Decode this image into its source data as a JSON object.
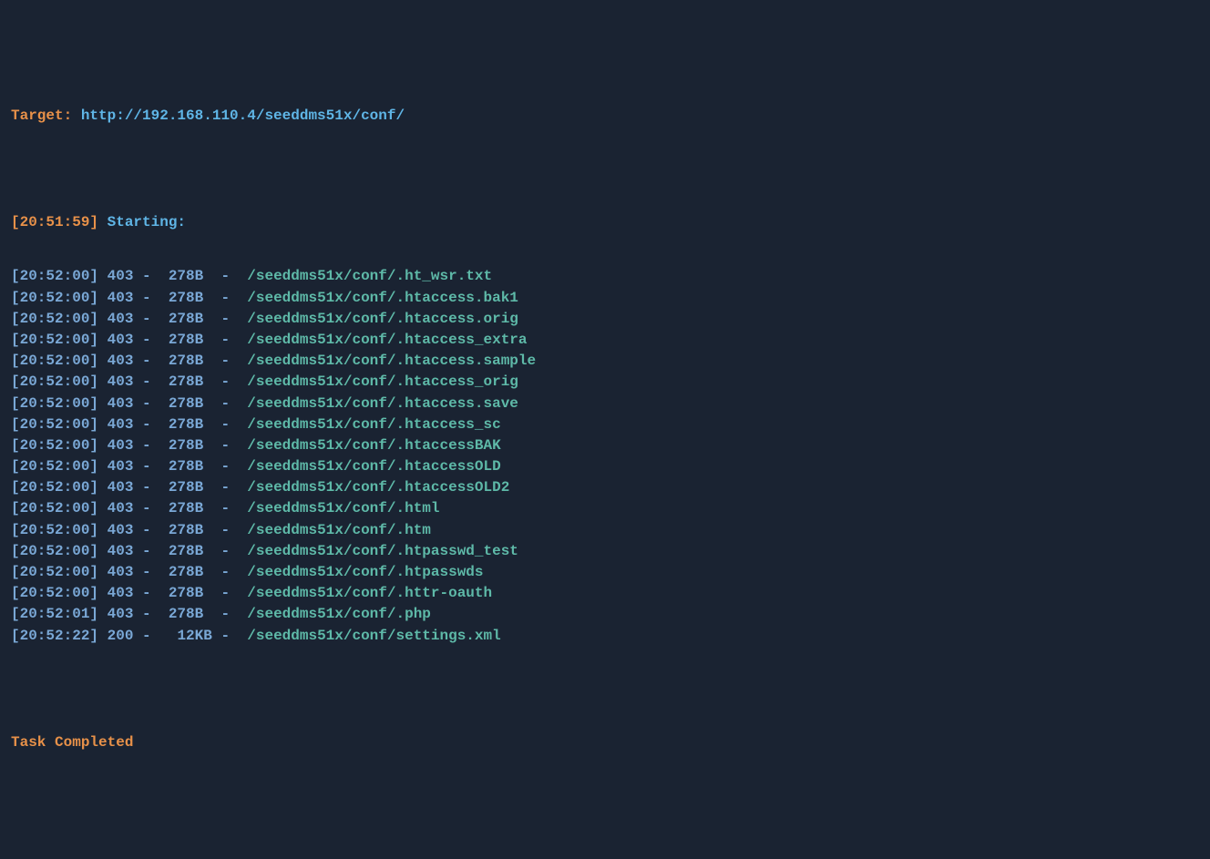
{
  "header": {
    "target_label": "Target: ",
    "target_url": "http://192.168.110.4/seeddms51x/conf/"
  },
  "starting": {
    "timestamp": "[20:51:59]",
    "label": " Starting:"
  },
  "entries": [
    {
      "timestamp": "[20:52:00]",
      "status": " 403 -  ",
      "size": "278B ",
      "dash": " - ",
      "path": " /seeddms51x/conf/.ht_wsr.txt"
    },
    {
      "timestamp": "[20:52:00]",
      "status": " 403 -  ",
      "size": "278B ",
      "dash": " - ",
      "path": " /seeddms51x/conf/.htaccess.bak1"
    },
    {
      "timestamp": "[20:52:00]",
      "status": " 403 -  ",
      "size": "278B ",
      "dash": " - ",
      "path": " /seeddms51x/conf/.htaccess.orig"
    },
    {
      "timestamp": "[20:52:00]",
      "status": " 403 -  ",
      "size": "278B ",
      "dash": " - ",
      "path": " /seeddms51x/conf/.htaccess_extra"
    },
    {
      "timestamp": "[20:52:00]",
      "status": " 403 -  ",
      "size": "278B ",
      "dash": " - ",
      "path": " /seeddms51x/conf/.htaccess.sample"
    },
    {
      "timestamp": "[20:52:00]",
      "status": " 403 -  ",
      "size": "278B ",
      "dash": " - ",
      "path": " /seeddms51x/conf/.htaccess_orig"
    },
    {
      "timestamp": "[20:52:00]",
      "status": " 403 -  ",
      "size": "278B ",
      "dash": " - ",
      "path": " /seeddms51x/conf/.htaccess.save"
    },
    {
      "timestamp": "[20:52:00]",
      "status": " 403 -  ",
      "size": "278B ",
      "dash": " - ",
      "path": " /seeddms51x/conf/.htaccess_sc"
    },
    {
      "timestamp": "[20:52:00]",
      "status": " 403 -  ",
      "size": "278B ",
      "dash": " - ",
      "path": " /seeddms51x/conf/.htaccessBAK"
    },
    {
      "timestamp": "[20:52:00]",
      "status": " 403 -  ",
      "size": "278B ",
      "dash": " - ",
      "path": " /seeddms51x/conf/.htaccessOLD"
    },
    {
      "timestamp": "[20:52:00]",
      "status": " 403 -  ",
      "size": "278B ",
      "dash": " - ",
      "path": " /seeddms51x/conf/.htaccessOLD2"
    },
    {
      "timestamp": "[20:52:00]",
      "status": " 403 -  ",
      "size": "278B ",
      "dash": " - ",
      "path": " /seeddms51x/conf/.html"
    },
    {
      "timestamp": "[20:52:00]",
      "status": " 403 -  ",
      "size": "278B ",
      "dash": " - ",
      "path": " /seeddms51x/conf/.htm"
    },
    {
      "timestamp": "[20:52:00]",
      "status": " 403 -  ",
      "size": "278B ",
      "dash": " - ",
      "path": " /seeddms51x/conf/.htpasswd_test"
    },
    {
      "timestamp": "[20:52:00]",
      "status": " 403 -  ",
      "size": "278B ",
      "dash": " - ",
      "path": " /seeddms51x/conf/.htpasswds"
    },
    {
      "timestamp": "[20:52:00]",
      "status": " 403 -  ",
      "size": "278B ",
      "dash": " - ",
      "path": " /seeddms51x/conf/.httr-oauth"
    },
    {
      "timestamp": "[20:52:01]",
      "status": " 403 -  ",
      "size": "278B ",
      "dash": " - ",
      "path": " /seeddms51x/conf/.php"
    },
    {
      "timestamp": "[20:52:22]",
      "status": " 200 -   ",
      "size": "12KB",
      "dash": " - ",
      "path": " /seeddms51x/conf/settings.xml"
    }
  ],
  "footer": {
    "completed": "Task Completed"
  }
}
